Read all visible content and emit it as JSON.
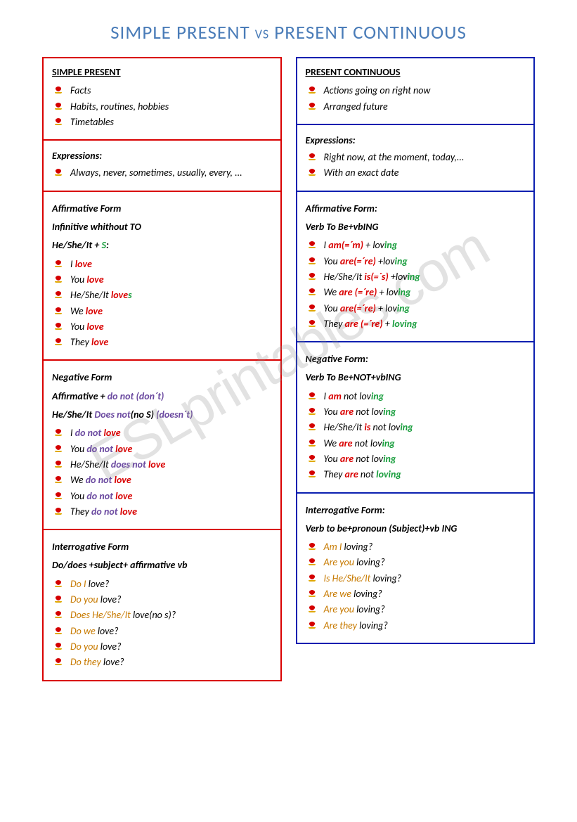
{
  "title": {
    "left": "SIMPLE PRESENT",
    "vs": "VS",
    "right": "PRESENT CONTINUOUS"
  },
  "watermark": "ESLprintables.com",
  "simple": {
    "header": "SIMPLE PRESENT",
    "uses": [
      "Facts",
      "Habits, routines, hobbies",
      "Timetables"
    ],
    "expr_label": "Expressions:",
    "expressions": [
      "Always, never, sometimes, usually, every, ..."
    ],
    "aff": {
      "title": "Affirmative Form",
      "rule1": "Infinitive whithout TO",
      "rule2_pre": "He/She/It + ",
      "rule2_s": "S",
      "rule2_post": ":",
      "items": [
        {
          "pre": "I ",
          "verb": "love",
          "suf": ""
        },
        {
          "pre": "You ",
          "verb": "love",
          "suf": ""
        },
        {
          "pre": "He/She/It ",
          "verb": "love",
          "suf": "s"
        },
        {
          "pre": "We ",
          "verb": "love",
          "suf": ""
        },
        {
          "pre": "You ",
          "verb": "love",
          "suf": ""
        },
        {
          "pre": "They ",
          "verb": "love",
          "suf": ""
        }
      ]
    },
    "neg": {
      "title": "Negative Form",
      "rule1_pre": "Affirmative + ",
      "rule1_aux": "do not (don´t)",
      "rule2_pre": "He/She/It ",
      "rule2_aux": "Does not",
      "rule2_mid": "(no S) ",
      "rule2_aux2": "(doesn´t)",
      "items": [
        {
          "pre": "I ",
          "aux": "do not ",
          "verb": "love"
        },
        {
          "pre": "You ",
          "aux": "do not ",
          "verb": "love"
        },
        {
          "pre": "He/She/It ",
          "aux": "does not ",
          "verb": "love"
        },
        {
          "pre": "We ",
          "aux": "do not ",
          "verb": "love"
        },
        {
          "pre": "You ",
          "aux": "do not ",
          "verb": "love"
        },
        {
          "pre": "They ",
          "aux": "do not ",
          "verb": "love"
        }
      ]
    },
    "int": {
      "title": "Interrogative Form",
      "rule": "Do/does +subject+ affirmative vb",
      "items": [
        {
          "aux": "Do I ",
          "rest": "love?"
        },
        {
          "aux": "Do you ",
          "rest": "love?"
        },
        {
          "aux": "Does He/She/It ",
          "rest": "love(no s)?"
        },
        {
          "aux": "Do we ",
          "rest": "love?"
        },
        {
          "aux": "Do you ",
          "rest": "love?"
        },
        {
          "aux": "Do they ",
          "rest": "love?"
        }
      ]
    }
  },
  "cont": {
    "header": "PRESENT CONTINUOUS",
    "uses": [
      "Actions going on right now",
      "Arranged future"
    ],
    "expr_label": "Expressions:",
    "expressions": [
      "Right now, at the moment, today,...",
      "With an exact date"
    ],
    "aff": {
      "title": "Affirmative Form:",
      "rule": "Verb To Be+vbING",
      "items": [
        {
          "pre": "I ",
          "be": "am(=´m)",
          "mid": " + lov",
          "ing": "ing"
        },
        {
          "pre": "You ",
          "be": "are(=´re)",
          "mid": " +lov",
          "ing": "ing"
        },
        {
          "pre": "He/She/It ",
          "be": "is(=´s)",
          "mid": " +lov",
          "ing": "ing"
        },
        {
          "pre": "We ",
          "be": "are (=´re)",
          "mid": " + lov",
          "ing": "ing"
        },
        {
          "pre": "You ",
          "be": "are(=´re)",
          "mid": " + lov",
          "ing": "ing"
        },
        {
          "pre": "They ",
          "be": "are (=´re)",
          "mid": " + ",
          "ing": "loving"
        }
      ]
    },
    "neg": {
      "title": "Negative Form:",
      "rule": "Verb To Be+NOT+vbING",
      "items": [
        {
          "pre": "I ",
          "be": "am",
          "mid": " not lov",
          "ing": "ing"
        },
        {
          "pre": "You ",
          "be": "are",
          "mid": " not lov",
          "ing": "ing"
        },
        {
          "pre": "He/She/It ",
          "be": "is",
          "mid": " not lov",
          "ing": "ing"
        },
        {
          "pre": "We ",
          "be": "are",
          "mid": " not lov",
          "ing": "ing"
        },
        {
          "pre": "You ",
          "be": "are",
          "mid": " not lov",
          "ing": "ing"
        },
        {
          "pre": "They ",
          "be": "are",
          "mid": " not ",
          "ing": "loving"
        }
      ]
    },
    "int": {
      "title": "Interrogative Form:",
      "rule": "Verb to be+pronoun (Subject)+vb ING",
      "items": [
        {
          "aux": "Am I ",
          "rest": "loving?"
        },
        {
          "aux": "Are you ",
          "rest": "loving?"
        },
        {
          "aux": "Is He/She/It ",
          "rest": "loving?"
        },
        {
          "aux": "Are we ",
          "rest": "loving?"
        },
        {
          "aux": "Are you ",
          "rest": "loving?"
        },
        {
          "aux": "Are they ",
          "rest": "loving?"
        }
      ]
    }
  }
}
